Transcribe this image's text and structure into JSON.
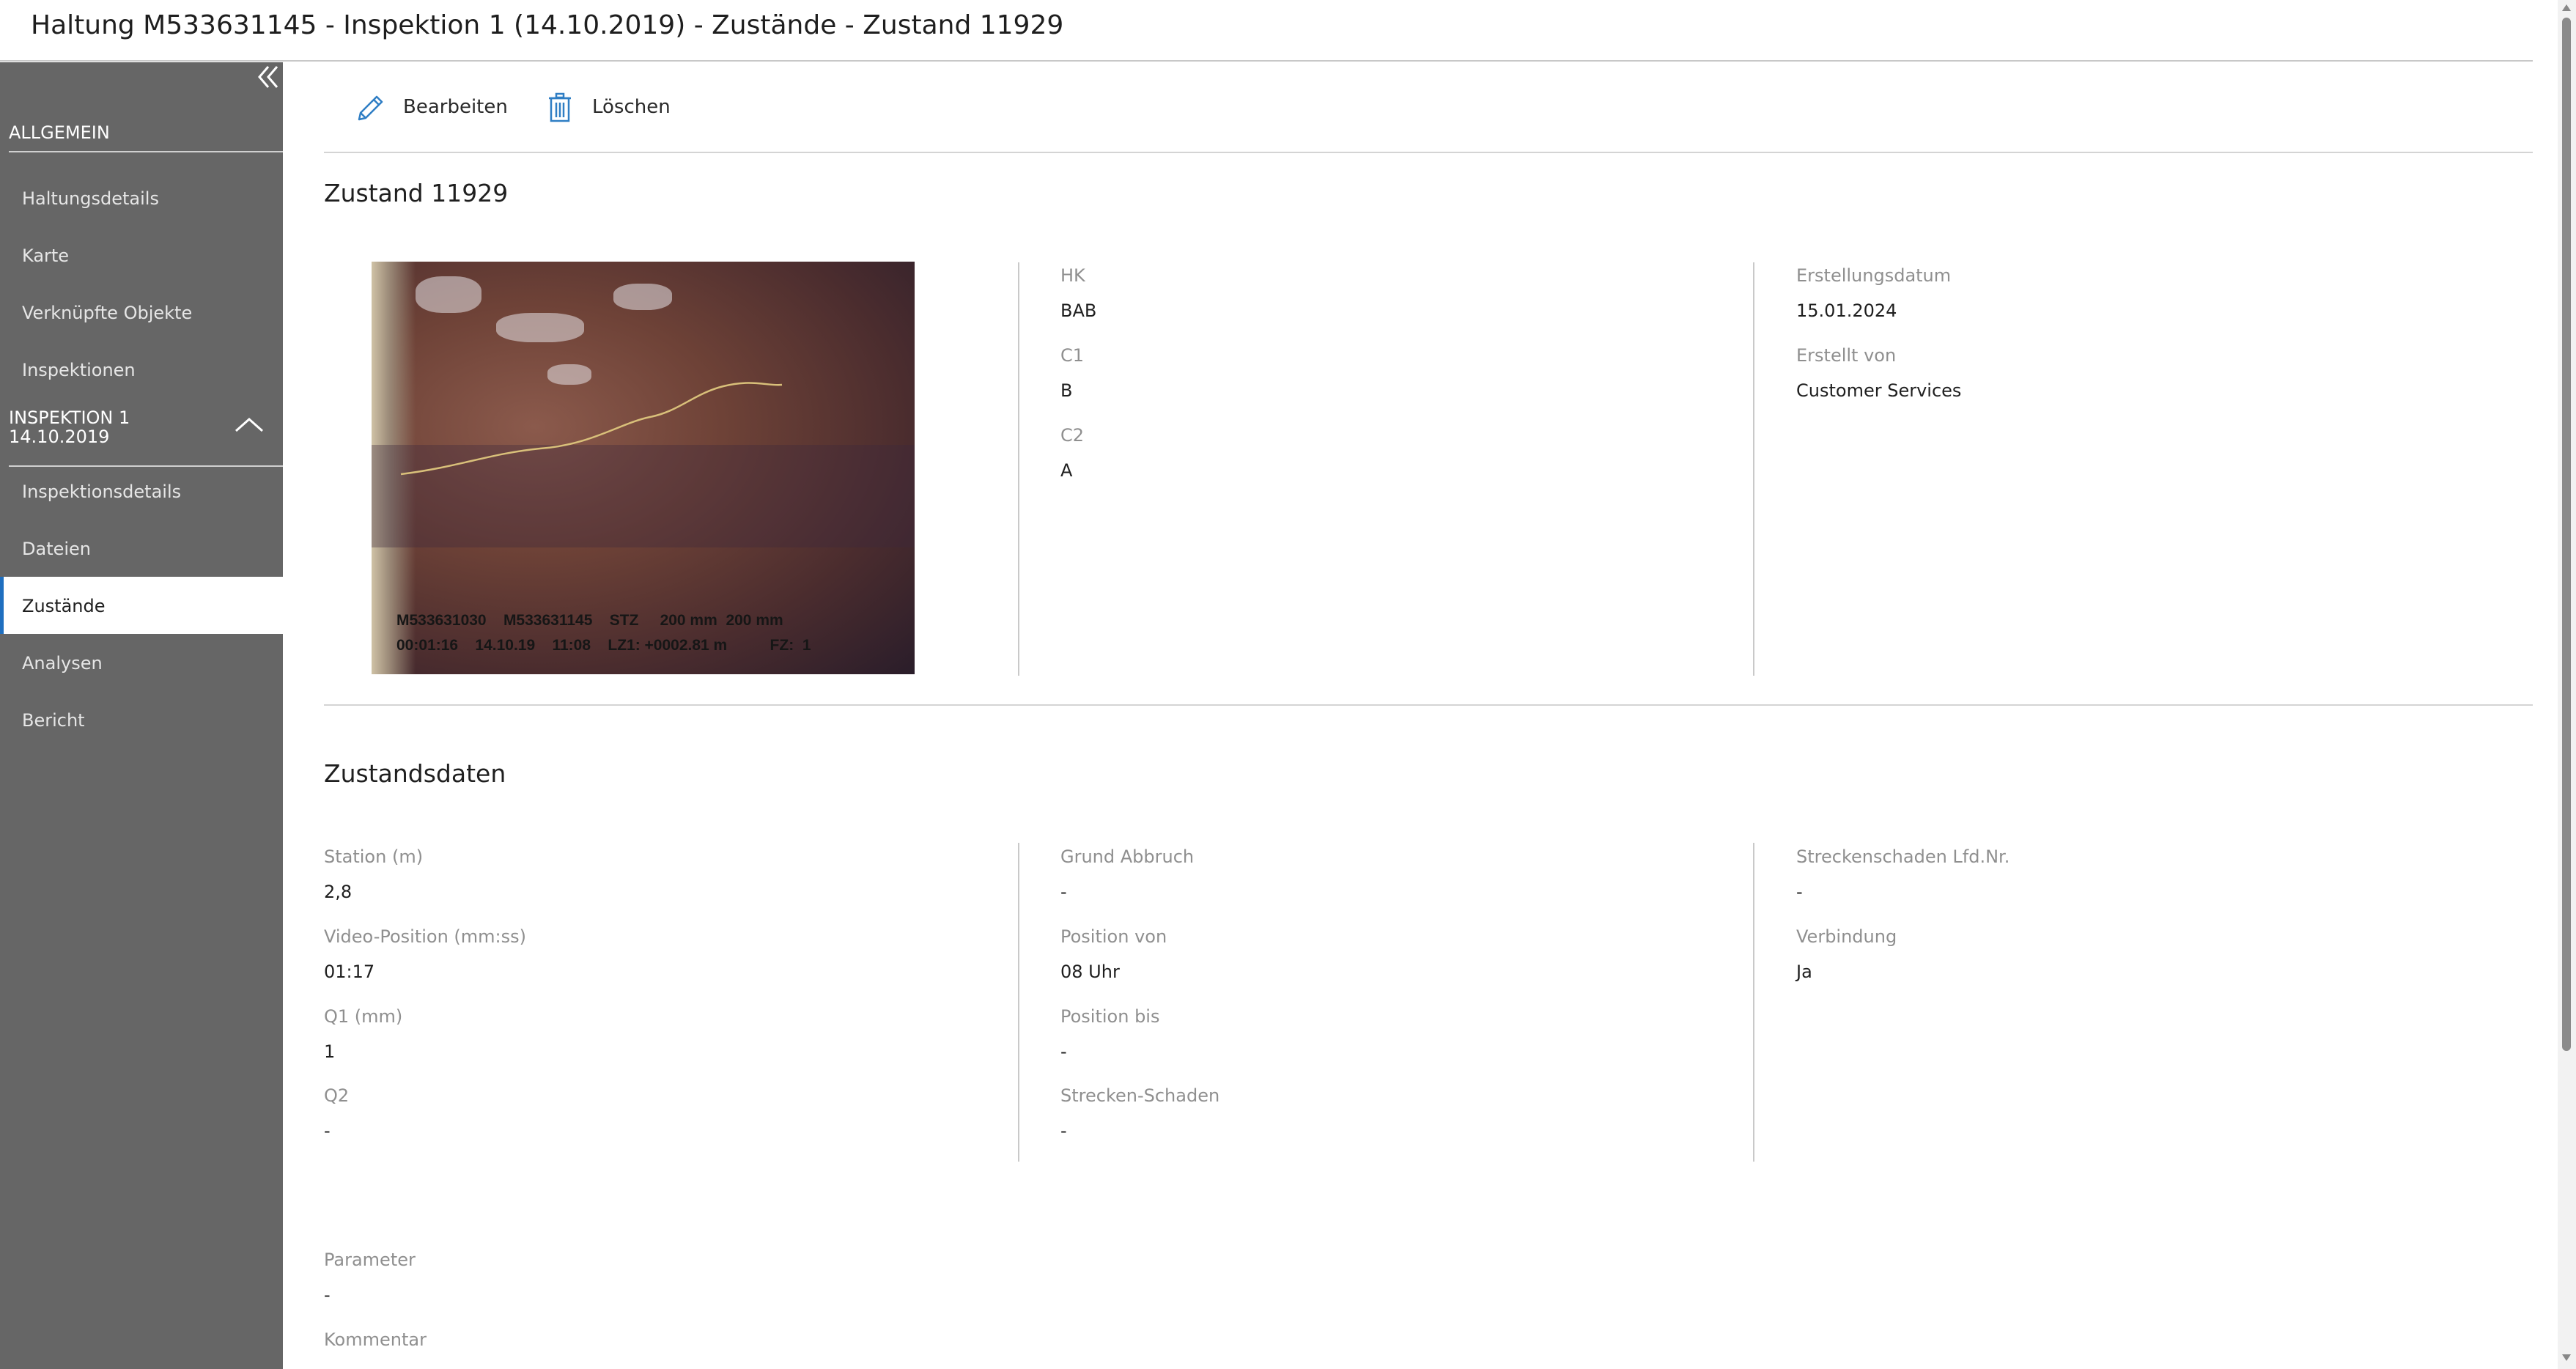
{
  "window": {
    "title": "Haltung M533631145 - Inspektion 1 (14.10.2019) - Zustände - Zustand 11929"
  },
  "sidebar": {
    "collapse_icon": "double-chevron-left-icon",
    "section_general": "ALLGEMEIN",
    "general_items": [
      {
        "label": "Haltungsdetails"
      },
      {
        "label": "Karte"
      },
      {
        "label": "Verknüpfte Objekte"
      },
      {
        "label": "Inspektionen"
      }
    ],
    "section_inspection": {
      "line1": "INSPEKTION 1",
      "line2": "14.10.2019",
      "icon": "chevron-up-icon"
    },
    "inspection_items": [
      {
        "label": "Inspektionsdetails"
      },
      {
        "label": "Dateien"
      },
      {
        "label": "Zustände",
        "active": true
      },
      {
        "label": "Analysen"
      },
      {
        "label": "Bericht"
      }
    ]
  },
  "toolbar": {
    "edit_label": "Bearbeiten",
    "edit_icon": "pencil-icon",
    "delete_label": "Löschen",
    "delete_icon": "trash-icon"
  },
  "condition": {
    "title": "Zustand 11929",
    "photo_overlay": {
      "line1": "M533631030    M533631145    STZ     200 mm  200 mm",
      "line2": "00:01:16    14.10.19    11:08    LZ1: +0002.81 m          FZ:  1"
    },
    "fields_col2": [
      {
        "label": "HK",
        "value": "BAB"
      },
      {
        "label": "C1",
        "value": "B"
      },
      {
        "label": "C2",
        "value": "A"
      }
    ],
    "fields_col3": [
      {
        "label": "Erstellungsdatum",
        "value": "15.01.2024"
      },
      {
        "label": "Erstellt von",
        "value": "Customer Services"
      }
    ]
  },
  "condition_data": {
    "title": "Zustandsdaten",
    "col1": [
      {
        "label": "Station (m)",
        "value": "2,8"
      },
      {
        "label": "Video-Position (mm:ss)",
        "value": "01:17"
      },
      {
        "label": "Q1 (mm)",
        "value": "1"
      },
      {
        "label": "Q2",
        "value": "-"
      }
    ],
    "col2": [
      {
        "label": "Grund Abbruch",
        "value": "-"
      },
      {
        "label": "Position von",
        "value": "08 Uhr"
      },
      {
        "label": "Position bis",
        "value": "-"
      },
      {
        "label": "Strecken-Schaden",
        "value": "-"
      }
    ],
    "col3": [
      {
        "label": "Streckenschaden Lfd.Nr.",
        "value": "-"
      },
      {
        "label": "Verbindung",
        "value": "Ja"
      }
    ],
    "extra": [
      {
        "label": "Parameter",
        "value": "-"
      },
      {
        "label": "Kommentar",
        "value": ""
      }
    ]
  }
}
